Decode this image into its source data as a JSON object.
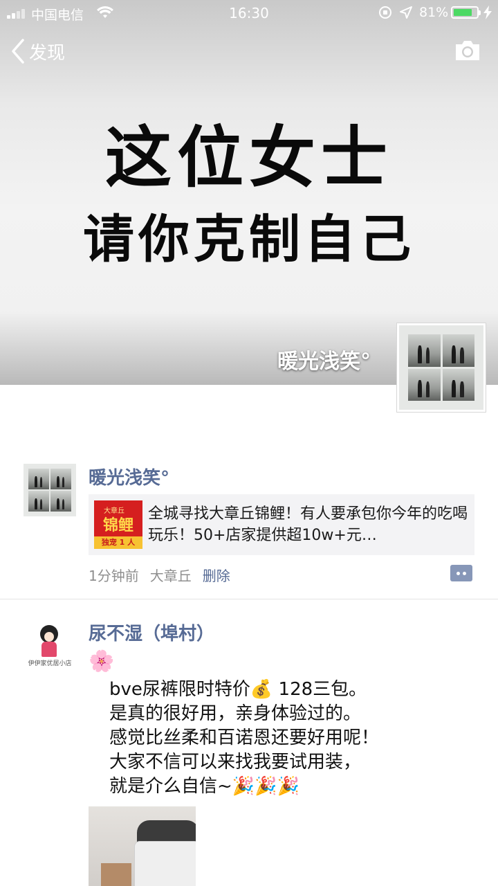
{
  "status_bar": {
    "carrier": "中国电信",
    "time": "16:30",
    "battery_percent": "81%",
    "battery_level": 0.81
  },
  "nav": {
    "back_label": "发现"
  },
  "cover": {
    "line1": "这位女士",
    "line2": "请你克制自己",
    "owner_name": "暖光浅笑°"
  },
  "posts": [
    {
      "author": "暖光浅笑°",
      "share": {
        "thumb_top": "大章丘",
        "thumb_mid": "锦鲤",
        "thumb_bottom": "独宠 1 人",
        "text": "全城寻找大章丘锦鲤！有人要承包你今年的吃喝玩乐！50+店家提供超10w+元…"
      },
      "time_ago": "1分钟前",
      "location": "大章丘",
      "delete_label": "删除"
    },
    {
      "author": "尿不湿（埠村）",
      "avatar_label": "伊伊家优居小店",
      "emoji_line": "🌸",
      "text": "bve尿裤限时特价💰 128三包。\n是真的很好用，亲身体验过的。\n感觉比丝柔和百诺恩还要好用呢！\n大家不信可以来找我要试用装，\n就是介么自信~🎉🎉🎉"
    }
  ],
  "colors": {
    "link_blue": "#576b95",
    "battery_green": "#4cd964",
    "meta_gray": "#8f8f8f"
  }
}
